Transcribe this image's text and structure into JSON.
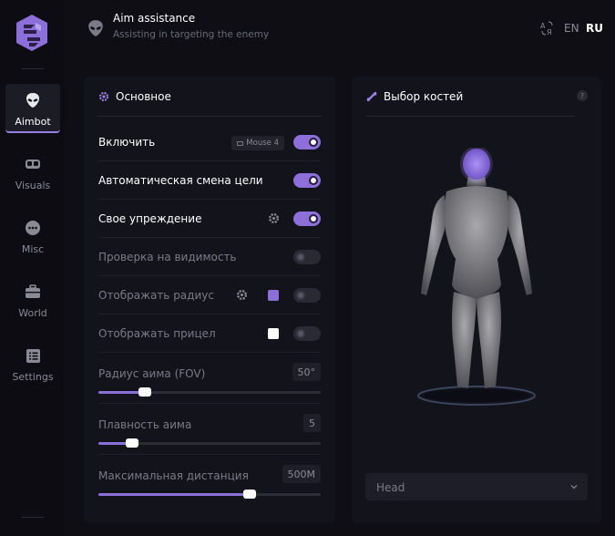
{
  "sidebar": {
    "items": [
      {
        "label": "Aimbot",
        "icon": "alien-icon",
        "active": true
      },
      {
        "label": "Visuals",
        "icon": "vr-goggles-icon"
      },
      {
        "label": "Misc",
        "icon": "dots-icon"
      },
      {
        "label": "World",
        "icon": "briefcase-icon"
      },
      {
        "label": "Settings",
        "icon": "list-icon"
      }
    ]
  },
  "header": {
    "title": "Aim assistance",
    "subtitle": "Assisting in targeting the enemy",
    "lang_en": "EN",
    "lang_ru": "RU"
  },
  "main_panel": {
    "title": "Основное",
    "rows": [
      {
        "label": "Включить",
        "state": "on",
        "bind": "Mouse 4"
      },
      {
        "label": "Автоматическая смена цели",
        "state": "on"
      },
      {
        "label": "Свое упреждение",
        "state": "on"
      },
      {
        "label": "Проверка на видимость",
        "state": "off"
      },
      {
        "label": "Отображать радиус",
        "state": "off",
        "swatch": "#8c6fd8"
      },
      {
        "label": "Отображать прицел",
        "state": "off",
        "swatch": "#ffffff"
      }
    ],
    "sliders": [
      {
        "label": "Радиус аима (FOV)",
        "value": "50°",
        "fraction": 0.21
      },
      {
        "label": "Плавность аима",
        "value": "5",
        "fraction": 0.15
      },
      {
        "label": "Максимальная дистанция",
        "value": "500M",
        "fraction": 0.68
      }
    ]
  },
  "bones_panel": {
    "title": "Выбор костей",
    "help": "?",
    "selected_bone": "Head"
  },
  "colors": {
    "accent": "#8c6fd8",
    "background": "#0e0e14",
    "panel": "#13131b"
  }
}
